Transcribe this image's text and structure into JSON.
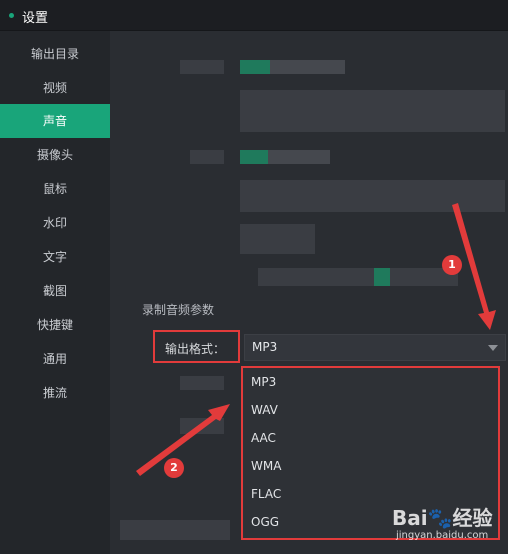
{
  "window": {
    "title": "设置"
  },
  "sidebar": {
    "items": [
      {
        "label": "输出目录"
      },
      {
        "label": "视频"
      },
      {
        "label": "声音",
        "active": true
      },
      {
        "label": "摄像头"
      },
      {
        "label": "鼠标"
      },
      {
        "label": "水印"
      },
      {
        "label": "文字"
      },
      {
        "label": "截图"
      },
      {
        "label": "快捷键"
      },
      {
        "label": "通用"
      },
      {
        "label": "推流"
      }
    ]
  },
  "audio": {
    "section_title": "录制音频参数",
    "format_label": "输出格式：",
    "format_value": "MP3",
    "options": [
      "MP3",
      "WAV",
      "AAC",
      "WMA",
      "FLAC",
      "OGG"
    ]
  },
  "annotations": {
    "step1": "1",
    "step2": "2"
  },
  "watermark": {
    "brand": "Bai🐾经验",
    "site": "jingyan.baidu.com"
  },
  "colors": {
    "accent": "#19a57a",
    "highlight": "#e23b3b"
  }
}
